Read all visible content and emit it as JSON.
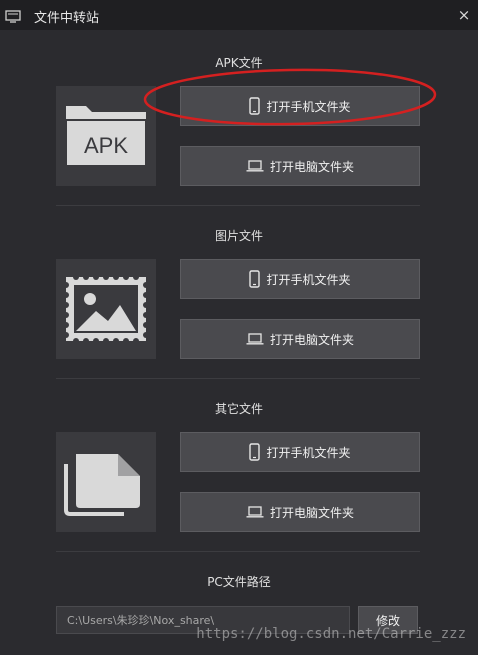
{
  "window": {
    "title": "文件中转站",
    "close_label": "×"
  },
  "sections": [
    {
      "title": "APK文件",
      "icon": "apk-folder-icon",
      "icon_text": "APK",
      "phone_button": "打开手机文件夹",
      "pc_button": "打开电脑文件夹"
    },
    {
      "title": "图片文件",
      "icon": "picture-icon",
      "phone_button": "打开手机文件夹",
      "pc_button": "打开电脑文件夹"
    },
    {
      "title": "其它文件",
      "icon": "files-icon",
      "phone_button": "打开手机文件夹",
      "pc_button": "打开电脑文件夹"
    }
  ],
  "pc_path": {
    "title": "PC文件路径",
    "value": "C:\\Users\\朱珍珍\\Nox_share\\",
    "modify_label": "修改"
  },
  "watermark": "https://blog.csdn.net/Carrie_zzz",
  "annotation": {
    "color": "#d42020",
    "shape": "ellipse"
  },
  "colors": {
    "background": "#2b2b2f",
    "titlebar": "#1f1f22",
    "button": "#4a4a4e",
    "icon_box": "#3a3a3e"
  }
}
